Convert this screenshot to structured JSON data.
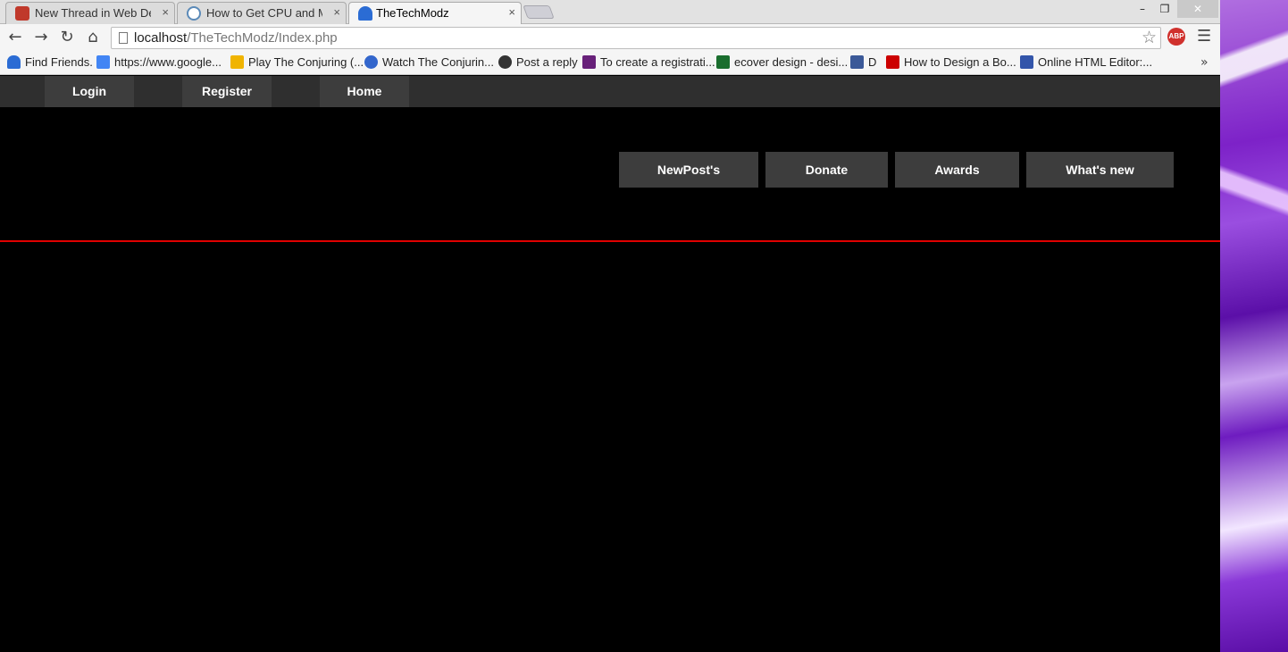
{
  "browser": {
    "tabs": [
      {
        "title": "New Thread in Web Devel",
        "favicon": "red-forum-icon",
        "color": "#c0392b"
      },
      {
        "title": "How to Get CPU and Mem",
        "favicon": "wordpress-icon",
        "color": "#5b8ab8"
      },
      {
        "title": "TheTechModz",
        "favicon": "user-icon",
        "color": "#2b6cd4",
        "active": true
      }
    ],
    "close_glyph": "×",
    "window_controls": {
      "minimize": "–",
      "restore": "❐",
      "close": "✕"
    },
    "url_host": "localhost",
    "url_path": "/TheTechModz/Index.php",
    "abp_label": "ABP",
    "bookmarks": [
      {
        "label": "Find Friends.",
        "icon": "user-icon",
        "color": "#2b6cd4"
      },
      {
        "label": "https://www.google...",
        "icon": "google-icon",
        "color": "#4285f4"
      },
      {
        "label": "Play The Conjuring (...",
        "icon": "bolt-icon",
        "color": "#f0b400"
      },
      {
        "label": "Watch The Conjurin...",
        "icon": "globe-icon",
        "color": "#3366cc"
      },
      {
        "label": "Post a reply",
        "icon": "spiral-icon",
        "color": "#333333"
      },
      {
        "label": "To create a registrati...",
        "icon": "visual-studio-icon",
        "color": "#68217a"
      },
      {
        "label": "ecover design - desi...",
        "icon": "w-icon",
        "color": "#1a6e2e"
      },
      {
        "label": "D",
        "icon": "facebook-icon",
        "color": "#3b5998"
      },
      {
        "label": "How to Design a Bo...",
        "icon": "youtube-icon",
        "color": "#cc0000"
      },
      {
        "label": "Online HTML Editor:...",
        "icon": "jw-icon",
        "color": "#3355aa"
      }
    ],
    "bookmarks_more": "»"
  },
  "site": {
    "top_nav": [
      "Login",
      "Register",
      "Home"
    ],
    "buttons": [
      "NewPost's",
      "Donate",
      "Awards",
      "What's new"
    ],
    "divider_color": "#e00000"
  }
}
